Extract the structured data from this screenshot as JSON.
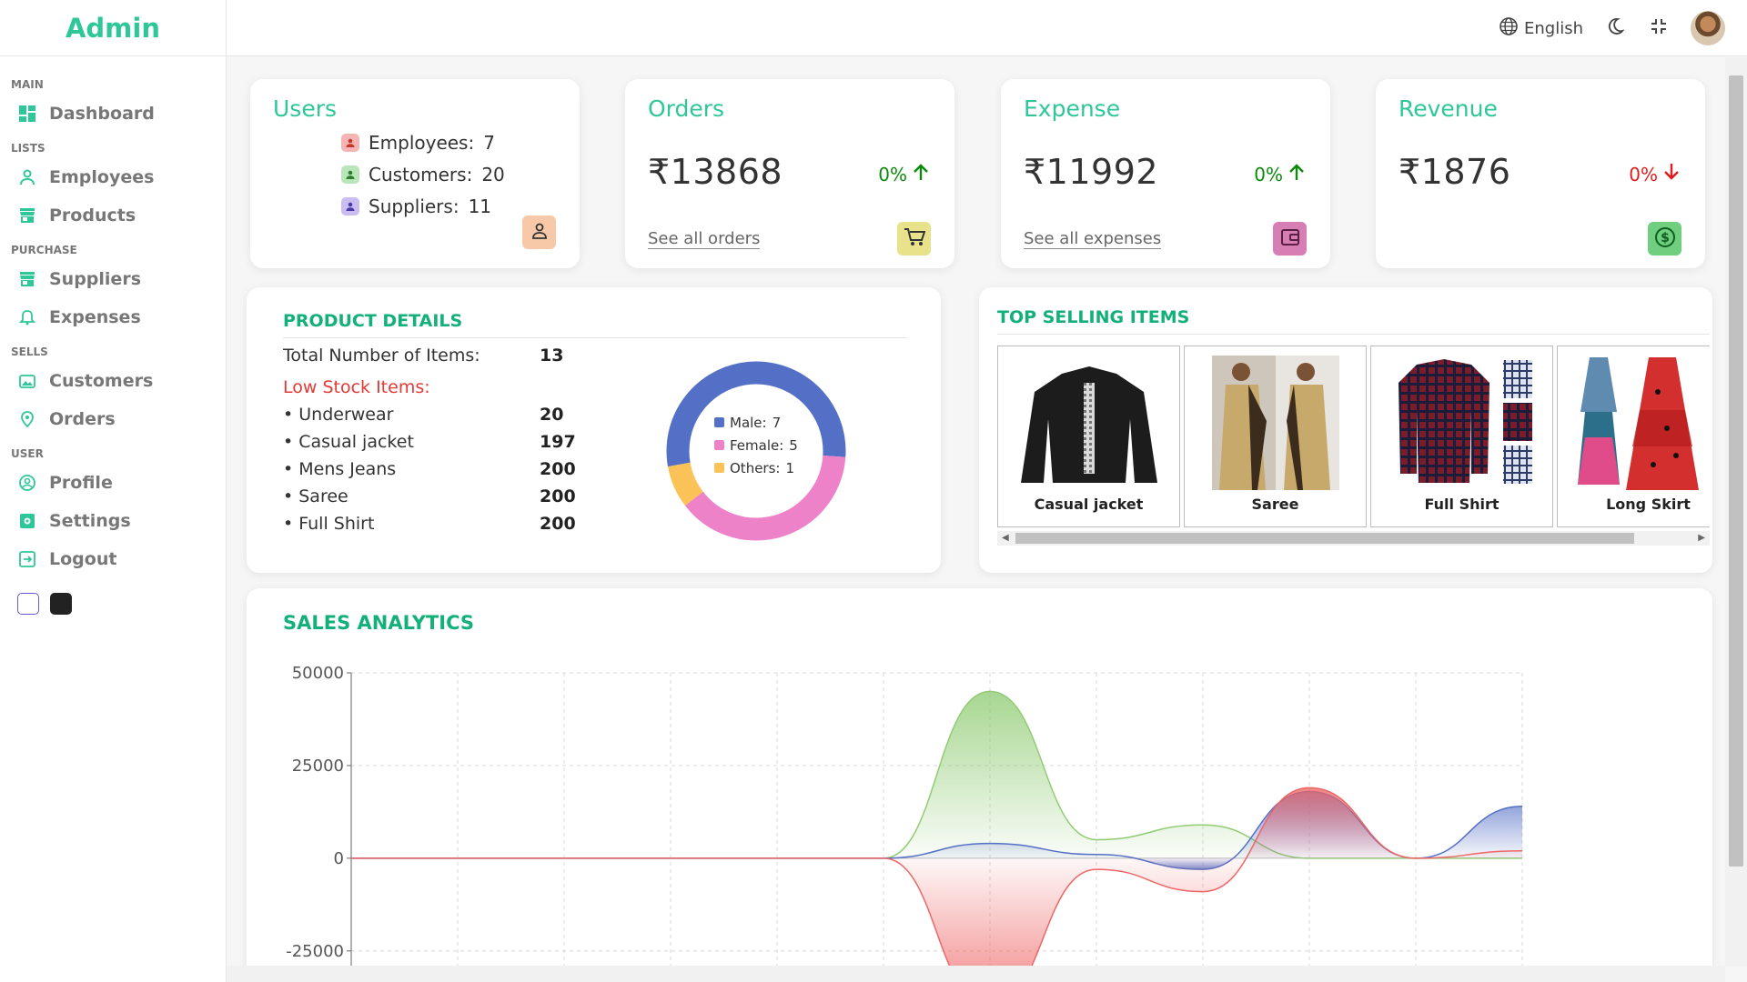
{
  "brand": "Admin",
  "sidebar": {
    "sections": [
      {
        "title": "MAIN",
        "items": [
          {
            "label": "Dashboard",
            "icon": "dashboard-icon"
          }
        ]
      },
      {
        "title": "LISTS",
        "items": [
          {
            "label": "Employees",
            "icon": "person-icon"
          },
          {
            "label": "Products",
            "icon": "store-icon"
          }
        ]
      },
      {
        "title": "PURCHASE",
        "items": [
          {
            "label": "Suppliers",
            "icon": "store-icon"
          },
          {
            "label": "Expenses",
            "icon": "bell-icon"
          }
        ]
      },
      {
        "title": "SELLS",
        "items": [
          {
            "label": "Customers",
            "icon": "image-icon"
          },
          {
            "label": "Orders",
            "icon": "location-icon"
          }
        ]
      },
      {
        "title": "USER",
        "items": [
          {
            "label": "Profile",
            "icon": "account-icon"
          },
          {
            "label": "Settings",
            "icon": "settings-icon"
          },
          {
            "label": "Logout",
            "icon": "logout-icon"
          }
        ]
      }
    ]
  },
  "topbar": {
    "language": "English"
  },
  "stats": {
    "users": {
      "title": "Users",
      "rows": [
        {
          "label": "Employees:",
          "value": "7",
          "color": "#e57373"
        },
        {
          "label": "Customers:",
          "value": "20",
          "color": "#66bb6a"
        },
        {
          "label": "Suppliers:",
          "value": "11",
          "color": "#7e6fd8"
        }
      ]
    },
    "orders": {
      "title": "Orders",
      "amount": "₹13868",
      "change": "0%",
      "direction": "up",
      "link": "See all orders",
      "icon_color": "#e8e38a"
    },
    "expense": {
      "title": "Expense",
      "amount": "₹11992",
      "change": "0%",
      "direction": "up",
      "link": "See all expenses",
      "icon_color": "#d77fb5"
    },
    "revenue": {
      "title": "Revenue",
      "amount": "₹1876",
      "change": "0%",
      "direction": "down",
      "icon_color": "#6fcf7f"
    }
  },
  "product_details": {
    "title": "PRODUCT DETAILS",
    "total_label": "Total Number of Items:",
    "total_value": "13",
    "low_stock_label": "Low Stock Items:",
    "items": [
      {
        "name": "• Underwear",
        "value": "20"
      },
      {
        "name": "• Casual jacket",
        "value": "197"
      },
      {
        "name": "• Mens Jeans",
        "value": "200"
      },
      {
        "name": "• Saree",
        "value": "200"
      },
      {
        "name": "• Full Shirt",
        "value": "200"
      }
    ],
    "donut": {
      "labels": [
        "Male:",
        "Female:",
        "Others:"
      ],
      "values": [
        7,
        5,
        1
      ],
      "colors": [
        "#5470c6",
        "#ee82c8",
        "#fbc357"
      ]
    }
  },
  "top_selling": {
    "title": "TOP SELLING ITEMS",
    "items": [
      "Casual jacket",
      "Saree",
      "Full Shirt",
      "Long Skirt"
    ]
  },
  "sales": {
    "title": "SALES ANALYTICS"
  },
  "chart_data": {
    "type": "area",
    "title": "SALES ANALYTICS",
    "xlabel": "",
    "ylabel": "",
    "ylim": [
      -40000,
      50000
    ],
    "yticks": [
      50000,
      25000,
      0,
      -25000
    ],
    "grid": true,
    "x": [
      0,
      1,
      2,
      3,
      4,
      5,
      6,
      7,
      8,
      9,
      10,
      11
    ],
    "series": [
      {
        "color": "#91cc75",
        "values": [
          0,
          0,
          0,
          0,
          0,
          0,
          45000,
          5000,
          9000,
          0,
          0,
          0
        ]
      },
      {
        "color": "#5470c6",
        "values": [
          0,
          0,
          0,
          0,
          0,
          0,
          4000,
          1000,
          -3000,
          18000,
          0,
          14000
        ]
      },
      {
        "color": "#ee6666",
        "values": [
          0,
          0,
          0,
          0,
          0,
          0,
          -40000,
          -3000,
          -9000,
          19000,
          0,
          2000
        ]
      }
    ]
  }
}
